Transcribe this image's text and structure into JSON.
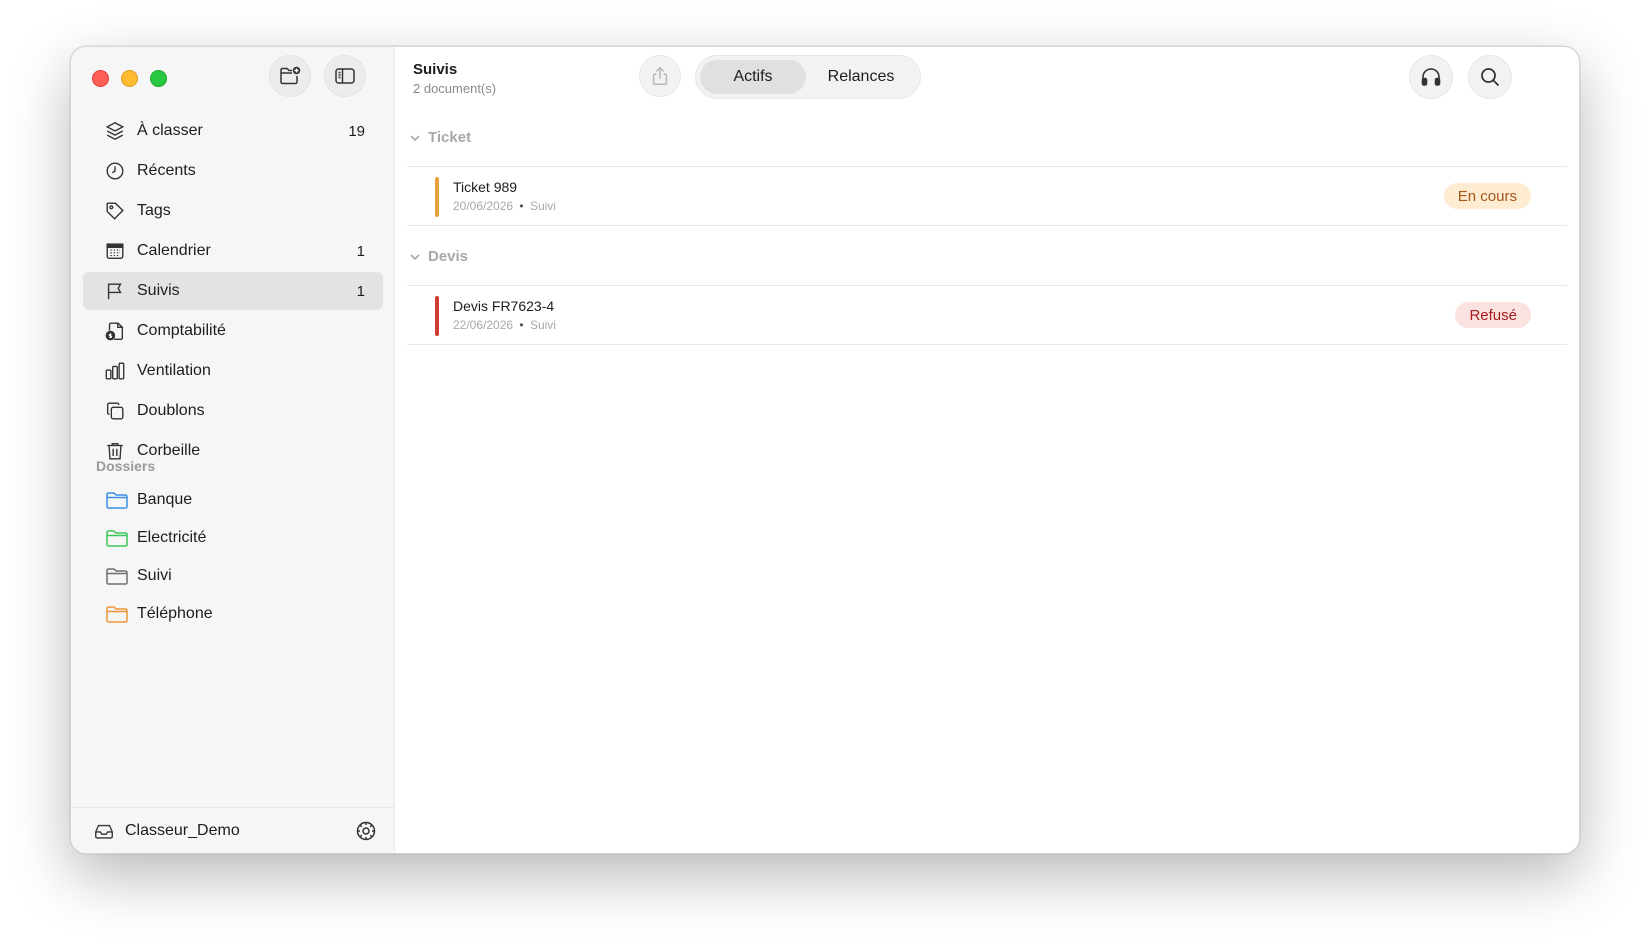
{
  "sidebar": {
    "nav": [
      {
        "label": "À classer",
        "count": "19",
        "icon": "layers-icon"
      },
      {
        "label": "Récents",
        "count": "",
        "icon": "clock-icon"
      },
      {
        "label": "Tags",
        "count": "",
        "icon": "tag-icon"
      },
      {
        "label": "Calendrier",
        "count": "1",
        "icon": "calendar-icon"
      },
      {
        "label": "Suivis",
        "count": "1",
        "icon": "flag-icon"
      },
      {
        "label": "Comptabilité",
        "count": "",
        "icon": "document-dollar-icon"
      },
      {
        "label": "Ventilation",
        "count": "",
        "icon": "bar-chart-icon"
      },
      {
        "label": "Doublons",
        "count": "",
        "icon": "duplicate-icon"
      },
      {
        "label": "Corbeille",
        "count": "",
        "icon": "trash-icon"
      }
    ],
    "active_index": 4,
    "folders_heading": "Dossiers",
    "folders": [
      {
        "label": "Banque",
        "color": "#3b8ee8"
      },
      {
        "label": "Electricité",
        "color": "#3cc558"
      },
      {
        "label": "Suivi",
        "color": "#6e6e6e"
      },
      {
        "label": "Téléphone",
        "color": "#f0953a"
      }
    ],
    "footer": {
      "label": "Classeur_Demo",
      "icon": "tray-icon"
    }
  },
  "main": {
    "title": "Suivis",
    "subtitle": "2 document(s)",
    "segments": [
      "Actifs",
      "Relances"
    ],
    "selected_segment": "Actifs",
    "groups": [
      {
        "name": "Ticket",
        "items": [
          {
            "name": "Ticket 989",
            "date": "20/06/2026",
            "folder": "Suivi",
            "status": "En cours",
            "bar_color": "#e8a33c",
            "badge_bg": "#fdecd2",
            "badge_fg": "#a5561b"
          }
        ]
      },
      {
        "name": "Devis",
        "items": [
          {
            "name": "Devis FR7623-4",
            "date": "22/06/2026",
            "folder": "Suivi",
            "status": "Refusé",
            "bar_color": "#d33b35",
            "badge_bg": "#fbe2e1",
            "badge_fg": "#a3201d"
          }
        ]
      }
    ],
    "meta_separator": "•"
  }
}
